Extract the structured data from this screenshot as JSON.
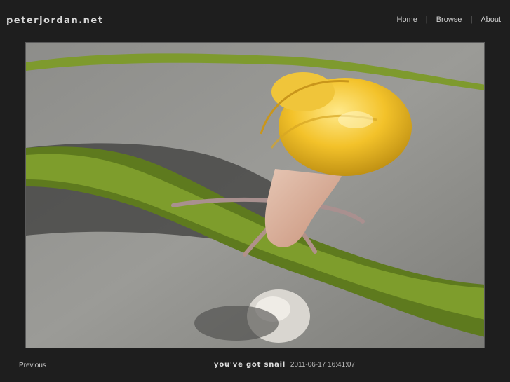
{
  "header": {
    "site_title": "peterjordan.net",
    "nav": [
      {
        "label": "Home"
      },
      {
        "label": "Browse"
      },
      {
        "label": "About"
      }
    ],
    "nav_separator": "|"
  },
  "photo": {
    "subject": "snail on pavement with moss"
  },
  "footer": {
    "previous_label": "Previous",
    "caption_title": "you've got snail",
    "caption_datetime": "2011-06-17 16:41:07"
  },
  "colors": {
    "background": "#1e1e1e",
    "text": "#cfcfcf",
    "frame_border": "#5a5a5a"
  }
}
